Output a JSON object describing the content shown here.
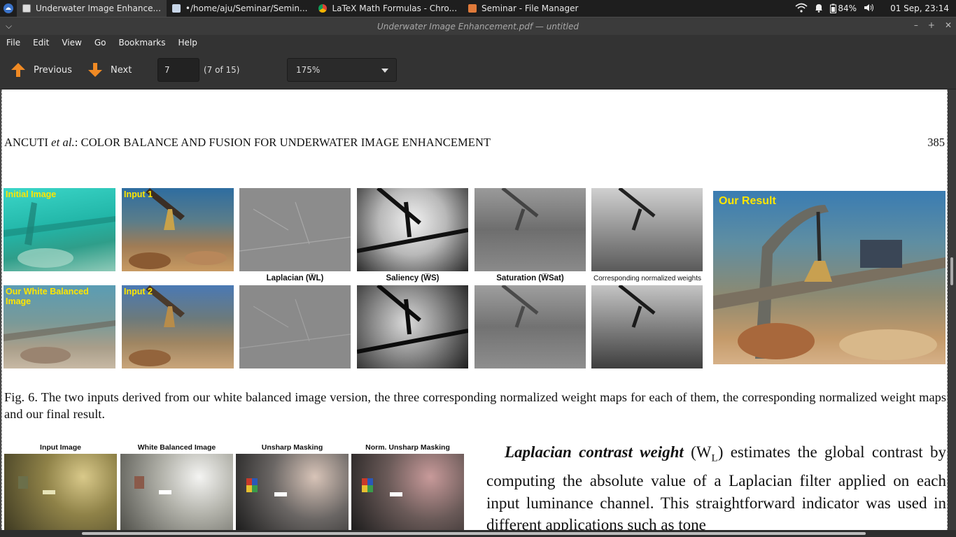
{
  "taskbar": {
    "tasks": [
      {
        "label": "Underwater Image Enhance...",
        "icon": "pdf-viewer-icon"
      },
      {
        "label": "•/home/aju/Seminar/Semin...",
        "icon": "text-editor-icon"
      },
      {
        "label": "LaTeX Math Formulas - Chro...",
        "icon": "chrome-icon"
      },
      {
        "label": "Seminar - File Manager",
        "icon": "folder-icon"
      }
    ],
    "battery": "84%",
    "clock": "01 Sep, 23:14"
  },
  "window": {
    "title": "Underwater Image Enhancement.pdf — untitled"
  },
  "menu": [
    "File",
    "Edit",
    "View",
    "Go",
    "Bookmarks",
    "Help"
  ],
  "toolbar": {
    "previous_label": "Previous",
    "next_label": "Next",
    "page_value": "7",
    "page_of": "(7 of 15)",
    "zoom_value": "175%"
  },
  "document": {
    "running_head_authors": "ANCUTI",
    "running_head_etal": "et al.",
    "running_head_title": ": COLOR BALANCE AND FUSION FOR UNDERWATER IMAGE ENHANCEMENT",
    "page_number": "385",
    "figure": {
      "labels": {
        "initial": "Initial Image",
        "input1": "Input 1",
        "white_balanced": "Our White Balanced Image",
        "input2": "Input 2",
        "result": "Our Result",
        "laplacian": "Laplacian (W̅L)",
        "saliency": "Saliency (W̅S)",
        "saturation": "Saturation (W̅Sat)",
        "normalized": "Corresponding normalized weights"
      },
      "caption": "Fig. 6.   The two inputs derived from our white balanced image version, the three corresponding normalized weight maps for each of them, the corresponding normalized weight maps and our final result."
    },
    "second_figure_labels": [
      "Input Image",
      "White Balanced Image",
      "Unsharp Masking",
      "Norm. Unsharp Masking"
    ],
    "paragraph": {
      "title": "Laplacian contrast weight",
      "symbol": "(W",
      "subscript": "L",
      "symbol_close": ")",
      "body": " estimates the global contrast by computing the absolute value of a Laplacian filter applied on each input luminance channel. This straightforward indicator was used in different applications such as tone"
    }
  },
  "colors": {
    "caption_yellow": "#ffe600",
    "arrow_orange": "#f08a24"
  }
}
